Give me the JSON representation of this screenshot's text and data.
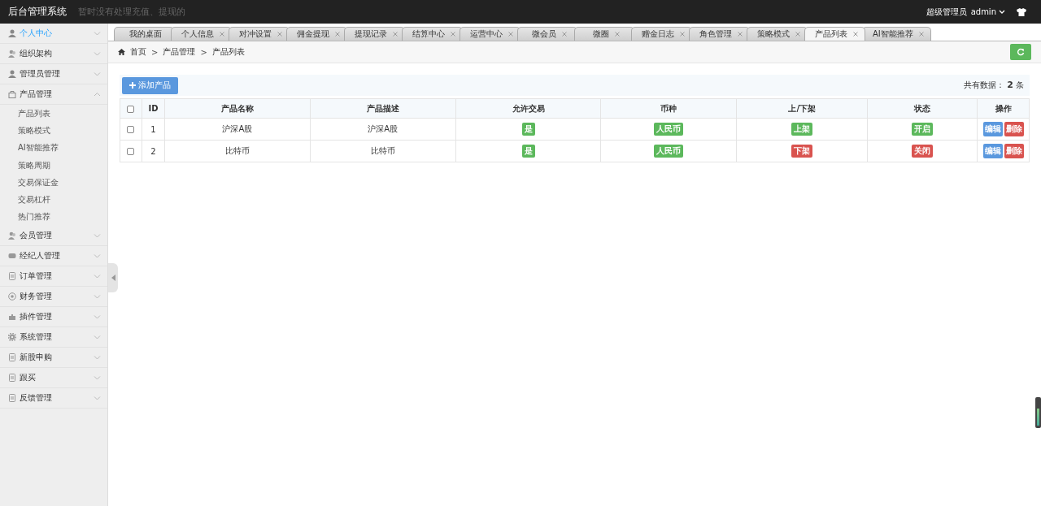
{
  "header": {
    "title": "后台管理系统",
    "notice": "暂时没有处理充值、提现的",
    "role": "超级管理员",
    "user": "admin"
  },
  "sidebar": {
    "items": [
      {
        "kind": "person",
        "label": "个人中心",
        "selected": true,
        "expanded": false
      },
      {
        "kind": "people",
        "label": "组织架构",
        "selected": false,
        "expanded": false
      },
      {
        "kind": "person",
        "label": "管理员管理",
        "selected": false,
        "expanded": false
      },
      {
        "kind": "bag",
        "label": "产品管理",
        "selected": false,
        "expanded": true,
        "children": [
          {
            "label": "产品列表"
          },
          {
            "label": "策略模式"
          },
          {
            "label": "AI智能推荐"
          },
          {
            "label": "策略周期"
          },
          {
            "label": "交易保证金"
          },
          {
            "label": "交易杠杆"
          },
          {
            "label": "热门推荐"
          }
        ]
      },
      {
        "kind": "people",
        "label": "会员管理",
        "selected": false,
        "expanded": false
      },
      {
        "kind": "card",
        "label": "经纪人管理",
        "selected": false,
        "expanded": false
      },
      {
        "kind": "doc",
        "label": "订单管理",
        "selected": false,
        "expanded": false
      },
      {
        "kind": "coin",
        "label": "财务管理",
        "selected": false,
        "expanded": false
      },
      {
        "kind": "puzzle",
        "label": "插件管理",
        "selected": false,
        "expanded": false
      },
      {
        "kind": "gear",
        "label": "系统管理",
        "selected": false,
        "expanded": false
      },
      {
        "kind": "doc",
        "label": "新股申购",
        "selected": false,
        "expanded": false
      },
      {
        "kind": "doc",
        "label": "跟买",
        "selected": false,
        "expanded": false
      },
      {
        "kind": "doc",
        "label": "反馈管理",
        "selected": false,
        "expanded": false
      }
    ]
  },
  "tabs": [
    {
      "label": "我的桌面",
      "selected": false,
      "closable": false
    },
    {
      "label": "个人信息",
      "selected": false,
      "closable": true
    },
    {
      "label": "对冲设置",
      "selected": false,
      "closable": true
    },
    {
      "label": "佣金提现",
      "selected": false,
      "closable": true
    },
    {
      "label": "提现记录",
      "selected": false,
      "closable": true
    },
    {
      "label": "结算中心",
      "selected": false,
      "closable": true
    },
    {
      "label": "运营中心",
      "selected": false,
      "closable": true
    },
    {
      "label": "微会员",
      "selected": false,
      "closable": true
    },
    {
      "label": "微圈",
      "selected": false,
      "closable": true
    },
    {
      "label": "赠金日志",
      "selected": false,
      "closable": true
    },
    {
      "label": "角色管理",
      "selected": false,
      "closable": true
    },
    {
      "label": "策略模式",
      "selected": false,
      "closable": true
    },
    {
      "label": "产品列表",
      "selected": true,
      "closable": true
    },
    {
      "label": "AI智能推荐",
      "selected": false,
      "closable": true
    }
  ],
  "breadcrumb": [
    {
      "label": "首页"
    },
    {
      "separator": ">",
      "label": "产品管理"
    },
    {
      "separator": ">",
      "label": "产品列表"
    }
  ],
  "toolbar": {
    "add_button": "添加产品",
    "total_label": "共有数据：",
    "total": "2",
    "total_unit": "条"
  },
  "table": {
    "all_checked": false,
    "columns": [
      "ID",
      "产品名称",
      "产品描述",
      "允许交易",
      "币种",
      "上/下架",
      "状态",
      "操作"
    ],
    "rows": [
      {
        "checked": false,
        "id": "1",
        "name": "沪深A股",
        "description": "沪深A股",
        "trade": {
          "text": "是",
          "on": true
        },
        "currency": {
          "text": "人民币",
          "on": true
        },
        "listing": {
          "text": "上架",
          "on": true
        },
        "status": {
          "text": "开启",
          "on": true
        },
        "actions": [
          "编辑",
          "删除"
        ]
      },
      {
        "checked": false,
        "id": "2",
        "name": "比特币",
        "description": "比特币",
        "trade": {
          "text": "是",
          "on": true
        },
        "currency": {
          "text": "人民币",
          "on": true
        },
        "listing": {
          "text": "下架",
          "on": false
        },
        "status": {
          "text": "关闭",
          "on": false
        },
        "actions": [
          "编辑",
          "删除"
        ]
      }
    ]
  }
}
